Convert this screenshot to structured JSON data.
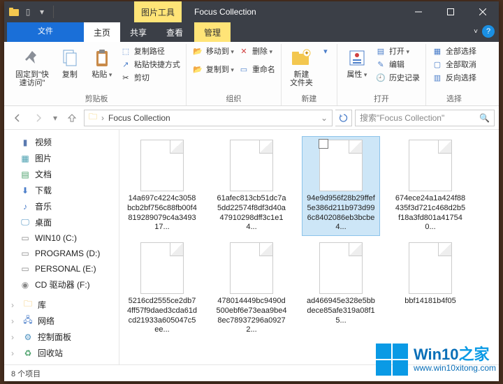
{
  "titlebar": {
    "context_tab": "图片工具",
    "title": "Focus Collection"
  },
  "tabs": {
    "file": "文件",
    "home": "主页",
    "share": "共享",
    "view": "查看",
    "manage": "管理"
  },
  "ribbon": {
    "clipboard": {
      "pin": "固定到\"快\n速访问\"",
      "copy": "复制",
      "paste": "粘贴",
      "copy_path": "复制路径",
      "paste_shortcut": "粘贴快捷方式",
      "cut": "剪切",
      "label": "剪贴板"
    },
    "organize": {
      "move_to": "移动到",
      "copy_to": "复制到",
      "delete": "删除",
      "rename": "重命名",
      "label": "组织"
    },
    "new": {
      "new_folder": "新建\n文件夹",
      "label": "新建"
    },
    "open": {
      "properties": "属性",
      "open": "打开",
      "edit": "编辑",
      "history": "历史记录",
      "label": "打开"
    },
    "select": {
      "all": "全部选择",
      "none": "全部取消",
      "invert": "反向选择",
      "label": "选择"
    }
  },
  "breadcrumb": {
    "folder": "Focus Collection"
  },
  "search": {
    "placeholder": "搜索\"Focus Collection\""
  },
  "nav": {
    "items": [
      {
        "icon": "video",
        "label": "视频"
      },
      {
        "icon": "pictures",
        "label": "图片"
      },
      {
        "icon": "documents",
        "label": "文档"
      },
      {
        "icon": "downloads",
        "label": "下载"
      },
      {
        "icon": "music",
        "label": "音乐"
      },
      {
        "icon": "desktop",
        "label": "桌面"
      },
      {
        "icon": "drive",
        "label": "WIN10 (C:)"
      },
      {
        "icon": "drive",
        "label": "PROGRAMS (D:)"
      },
      {
        "icon": "drive",
        "label": "PERSONAL (E:)"
      },
      {
        "icon": "disc",
        "label": "CD 驱动器 (F:)"
      }
    ],
    "items2": [
      {
        "icon": "library",
        "label": "库"
      },
      {
        "icon": "network",
        "label": "网络"
      },
      {
        "icon": "control",
        "label": "控制面板"
      },
      {
        "icon": "recycle",
        "label": "回收站"
      }
    ]
  },
  "files": [
    {
      "name": "14a697c4224c3058bcb2bf756c88fb00f4819289079c4a349317...",
      "selected": false
    },
    {
      "name": "61afec813cb51dc7a5dd22574f8df3d40a47910298dff3c1e14...",
      "selected": false
    },
    {
      "name": "94e9d956f28b29ffef5e386d211b973d996c8402086eb3bcbe4...",
      "selected": true
    },
    {
      "name": "674ece24a1a424f88435f3d721c468d2b5f18a3fd801a417540...",
      "selected": false
    },
    {
      "name": "5216cd2555ce2db74ff57f9daed3cda61dcd21933a605047c5ee...",
      "selected": false
    },
    {
      "name": "478014449bc9490d500ebf6e73eaa9be48ec78937296a09272...",
      "selected": false
    },
    {
      "name": "ad466945e328e5bbdece85afe319a08f15...",
      "selected": false
    },
    {
      "name": "bbf14181b4f05",
      "selected": false
    }
  ],
  "status": {
    "count": "8 个项目"
  },
  "watermark": {
    "brand_a": "Win10",
    "brand_b": "之家",
    "url": "www.win10xitong.com"
  }
}
